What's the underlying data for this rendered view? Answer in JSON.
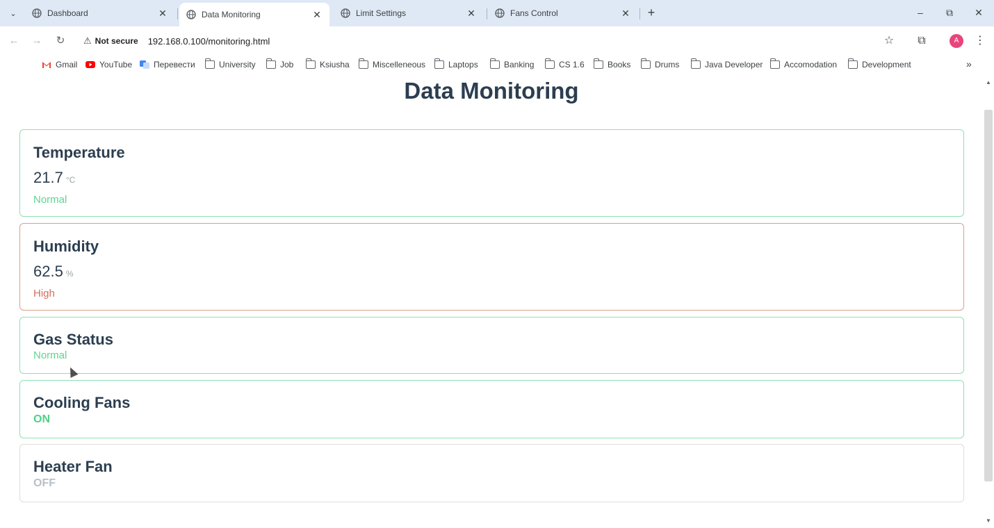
{
  "browser": {
    "tabs": [
      {
        "label": "Dashboard",
        "active": false
      },
      {
        "label": "Data Monitoring",
        "active": true
      },
      {
        "label": "Limit Settings",
        "active": false
      },
      {
        "label": "Fans Control",
        "active": false
      }
    ],
    "address": {
      "security_label": "Not secure",
      "url": "192.168.0.100/monitoring.html"
    },
    "avatar_letter": "A",
    "bookmarks": [
      {
        "label": "Gmail",
        "icon": "gmail-icon"
      },
      {
        "label": "YouTube",
        "icon": "youtube-icon"
      },
      {
        "label": "Перевести",
        "icon": "translate-icon"
      },
      {
        "label": "University",
        "icon": "folder-icon"
      },
      {
        "label": "Job",
        "icon": "folder-icon"
      },
      {
        "label": "Ksiusha",
        "icon": "folder-icon"
      },
      {
        "label": "Miscelleneous",
        "icon": "folder-icon"
      },
      {
        "label": "Laptops",
        "icon": "folder-icon"
      },
      {
        "label": "Banking",
        "icon": "folder-icon"
      },
      {
        "label": "CS 1.6",
        "icon": "folder-icon"
      },
      {
        "label": "Books",
        "icon": "folder-icon"
      },
      {
        "label": "Drums",
        "icon": "folder-icon"
      },
      {
        "label": "Java Developer",
        "icon": "folder-icon"
      },
      {
        "label": "Accomodation",
        "icon": "folder-icon"
      },
      {
        "label": "Development",
        "icon": "folder-icon"
      }
    ]
  },
  "page": {
    "title": "Data Monitoring",
    "temperature": {
      "title": "Temperature",
      "value": "21.7",
      "unit": "°C",
      "status": "Normal"
    },
    "humidity": {
      "title": "Humidity",
      "value": "62.5",
      "unit": "%",
      "status": "High"
    },
    "gas": {
      "title": "Gas Status",
      "status": "Normal"
    },
    "cooling": {
      "title": "Cooling Fans",
      "state": "ON"
    },
    "heater": {
      "title": "Heater Fan",
      "state": "OFF"
    }
  },
  "colors": {
    "ok_border": "#8fe0b3",
    "warn_border": "#d9a08a",
    "status_green": "#5fd38f",
    "status_red": "#d0705a",
    "heading": "#2c3e50"
  }
}
